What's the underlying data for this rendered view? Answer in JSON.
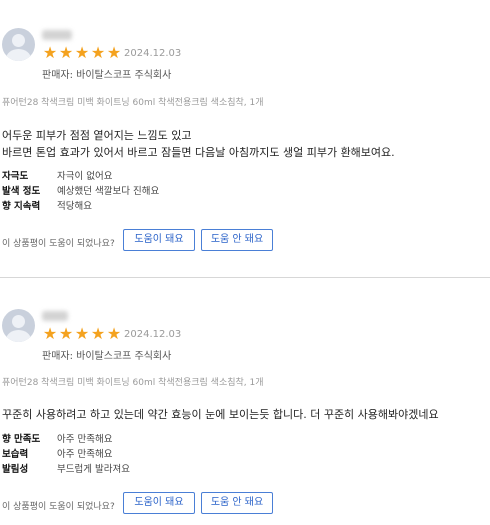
{
  "reviews": [
    {
      "rating": 5,
      "date": "2024.12.03",
      "seller": "판매자: 바이탈스코프 주식회사",
      "option": "퓨어턴28 착색크림 미백 화이트닝 60ml 착색전용크림 색소침착, 1개",
      "content_lines": [
        "어두운 피부가 점점 옅어지는 느낌도 있고",
        "바르면 톤업 효과가 있어서 바르고 잠들면 다음날 아침까지도 생얼 피부가 환해보여요."
      ],
      "attributes": [
        {
          "key": "자극도",
          "value": "자극이 없어요"
        },
        {
          "key": "발색 정도",
          "value": "예상했던 색깔보다 진해요"
        },
        {
          "key": "향 지속력",
          "value": "적당해요"
        }
      ],
      "helpful_question": "이 상품평이 도움이 되었나요?",
      "helpful_yes": "도움이 돼요",
      "helpful_no": "도움 안 돼요"
    },
    {
      "rating": 5,
      "date": "2024.12.03",
      "seller": "판매자: 바이탈스코프 주식회사",
      "option": "퓨어턴28 착색크림 미백 화이트닝 60ml 착색전용크림 색소침착, 1개",
      "content_lines": [
        "꾸준히 사용하려고 하고 있는데 약간 효능이 눈에 보이는듯 합니다. 더 꾸준히 사용해봐야겠네요"
      ],
      "attributes": [
        {
          "key": "향 만족도",
          "value": "아주 만족해요"
        },
        {
          "key": "보습력",
          "value": "아주 만족해요"
        },
        {
          "key": "발림성",
          "value": "부드럽게 발라져요"
        }
      ],
      "helpful_question": "이 상품평이 도움이 되었나요?",
      "helpful_yes": "도움이 돼요",
      "helpful_no": "도움 안 돼요"
    }
  ],
  "colors": {
    "star": "#f4a21f",
    "button_border": "#4a7fd6",
    "button_text": "#2a62c9",
    "divider": "#d7d7d7"
  },
  "icons": {
    "avatar": "user-avatar-icon",
    "star": "star-icon"
  }
}
